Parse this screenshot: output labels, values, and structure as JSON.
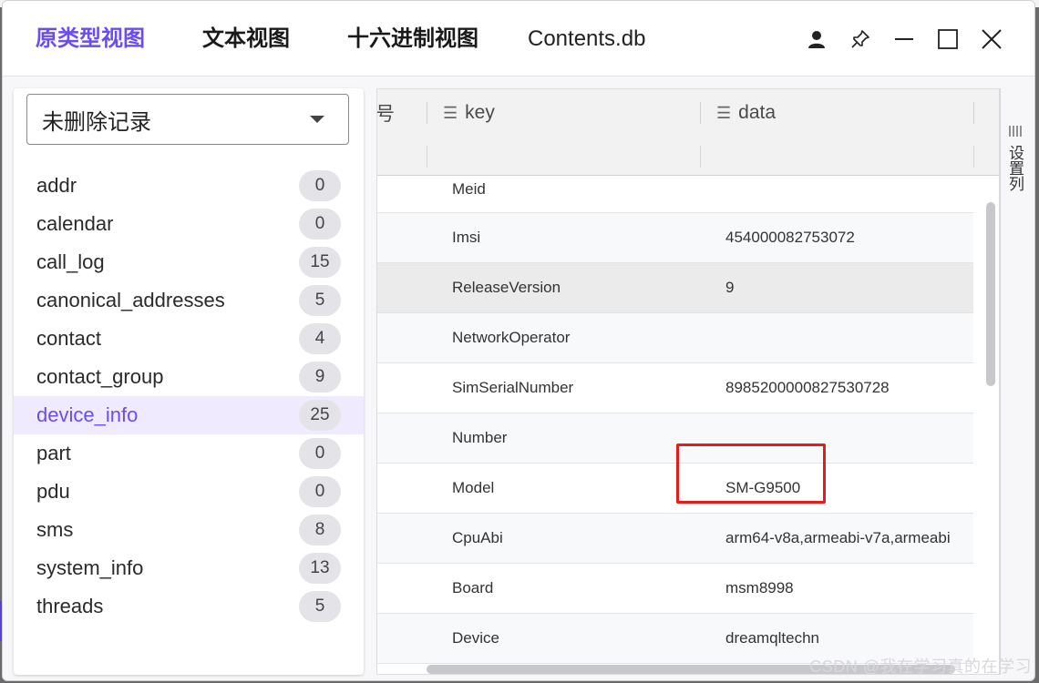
{
  "titlebar": {
    "tabs": [
      {
        "label": "原类型视图",
        "active": true
      },
      {
        "label": "文本视图",
        "active": false
      },
      {
        "label": "十六进制视图",
        "active": false
      }
    ],
    "file_name": "Contents.db",
    "icons": [
      "user-icon",
      "pin-icon",
      "minimize-icon",
      "maximize-icon",
      "close-icon"
    ]
  },
  "filter_dropdown": {
    "value": "未删除记录"
  },
  "tables": [
    {
      "name": "addr",
      "count": "0"
    },
    {
      "name": "calendar",
      "count": "0"
    },
    {
      "name": "call_log",
      "count": "15"
    },
    {
      "name": "canonical_addresses",
      "count": "5"
    },
    {
      "name": "contact",
      "count": "4"
    },
    {
      "name": "contact_group",
      "count": "9"
    },
    {
      "name": "device_info",
      "count": "25",
      "selected": true
    },
    {
      "name": "part",
      "count": "0"
    },
    {
      "name": "pdu",
      "count": "0"
    },
    {
      "name": "sms",
      "count": "8"
    },
    {
      "name": "system_info",
      "count": "13"
    },
    {
      "name": "threads",
      "count": "5"
    }
  ],
  "grid": {
    "columns": [
      {
        "label": "号",
        "icon": "truncated-column"
      },
      {
        "label": "key",
        "icon": "list-icon"
      },
      {
        "label": "data",
        "icon": "list-icon"
      }
    ],
    "rows": [
      {
        "key": "Meid",
        "data": ""
      },
      {
        "key": "Imsi",
        "data": "454000082753072"
      },
      {
        "key": "ReleaseVersion",
        "data": "9",
        "selected": true
      },
      {
        "key": "NetworkOperator",
        "data": ""
      },
      {
        "key": "SimSerialNumber",
        "data": "8985200000827530728"
      },
      {
        "key": "Number",
        "data": ""
      },
      {
        "key": "Model",
        "data": "SM-G9500",
        "highlighted": true
      },
      {
        "key": "CpuAbi",
        "data": "arm64-v8a,armeabi-v7a,armeabi"
      },
      {
        "key": "Board",
        "data": "msm8998"
      },
      {
        "key": "Device",
        "data": "dreamqltechn"
      }
    ],
    "highlight_color": "#e51c1c"
  },
  "column_settings": {
    "label": "设置列"
  },
  "watermark": "CSDN @我在学习真的在学习",
  "colors": {
    "accent": "#6b4cf0",
    "selected_row_bg": "#efeafd"
  }
}
